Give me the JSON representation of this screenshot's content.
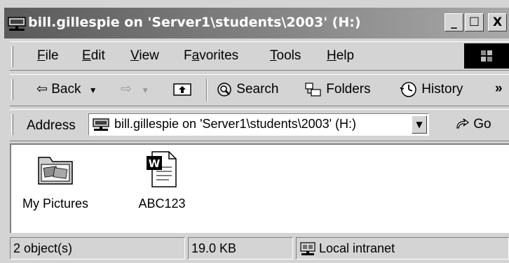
{
  "window": {
    "title": "bill.gillespie on 'Server1\\students\\2003' (H:)",
    "buttons": {
      "minimize": "_",
      "maximize": "☐",
      "close": "X"
    }
  },
  "menu": {
    "items": [
      {
        "id": "file",
        "label": "File",
        "underline": "F"
      },
      {
        "id": "edit",
        "label": "Edit",
        "underline": "E"
      },
      {
        "id": "view",
        "label": "View",
        "underline": "V"
      },
      {
        "id": "favorites",
        "label": "Favorites",
        "underline": "a"
      },
      {
        "id": "tools",
        "label": "Tools",
        "underline": "T"
      },
      {
        "id": "help",
        "label": "Help",
        "underline": "H"
      }
    ]
  },
  "toolbar": {
    "back": "Back",
    "search": "Search",
    "folders": "Folders",
    "history": "History",
    "more": "»"
  },
  "address": {
    "label": "Address",
    "value": "bill.gillespie on 'Server1\\students\\2003' (H:)",
    "go": "Go"
  },
  "files": [
    {
      "name": "My Pictures",
      "icon": "pictures-folder-icon"
    },
    {
      "name": "ABC123",
      "icon": "word-document-icon"
    }
  ],
  "status": {
    "objects": "2 object(s)",
    "size": "19.0 KB",
    "zone": "Local intranet"
  }
}
